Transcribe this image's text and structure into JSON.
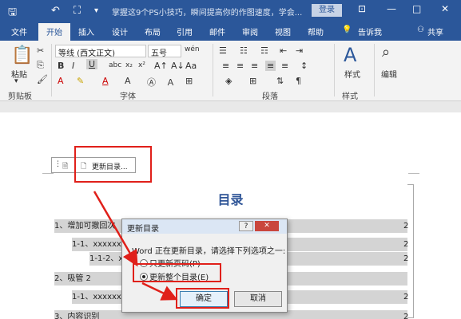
{
  "titlebar": {
    "doc_title": "掌握这9个PS小技巧，瞬间提高你的作图速度，学会...",
    "login": "登录",
    "min": "—",
    "restore": "□",
    "close": "✕"
  },
  "tabs": [
    "文件",
    "开始",
    "插入",
    "设计",
    "布局",
    "引用",
    "邮件",
    "审阅",
    "视图",
    "帮助"
  ],
  "tell_me": "告诉我",
  "share": "共享",
  "ribbon": {
    "paste": "粘贴",
    "font_name": "等线 (西文正文)",
    "font_size": "五号",
    "styles": "样式",
    "editing": "编辑",
    "group_clipboard": "剪贴板",
    "group_font": "字体",
    "group_paragraph": "段落",
    "group_styles": "样式"
  },
  "content_control": {
    "label": "更新目录..."
  },
  "toc": {
    "title": "目录",
    "lines": [
      {
        "text": "1、增加可撤回次",
        "num": "2"
      },
      {
        "text": "1-1、xxxxxx",
        "num": "2"
      },
      {
        "text": "1-1-2、xx",
        "num": "2"
      },
      {
        "text": "2、吸管 2",
        "num": ""
      },
      {
        "text": "1-1、xxxxxxx",
        "num": "2"
      },
      {
        "text": "3、内容识别",
        "num": "2"
      }
    ]
  },
  "dialog": {
    "title": "更新目录",
    "help": "?",
    "close": "✕",
    "message": "Word 正在更新目录，请选择下列选项之一:",
    "option_pages": "只更新页码(P)",
    "option_all": "更新整个目录(E)",
    "ok": "确定",
    "cancel": "取消"
  },
  "colors": {
    "brand": "#2b579a",
    "highlight": "#e0201a"
  }
}
